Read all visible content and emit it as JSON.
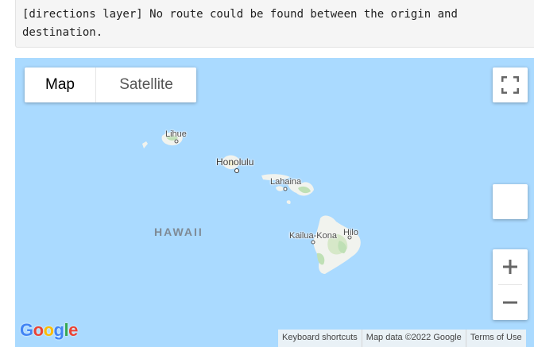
{
  "console": {
    "message": "[directions layer] No route could be found between the origin and\ndestination."
  },
  "map": {
    "type_control": {
      "map_label": "Map",
      "satellite_label": "Satellite",
      "selected": "Map"
    },
    "labels": {
      "lihue": "Lihue",
      "honolulu": "Honolulu",
      "lahaina": "Lahaina",
      "state": "HAWAII",
      "kailua_kona": "Kailua-Kona",
      "hilo": "Hilo"
    },
    "logo": {
      "letters": [
        "G",
        "o",
        "o",
        "g",
        "l",
        "e"
      ],
      "colors": [
        "#4285F4",
        "#EA4335",
        "#FBBC05",
        "#4285F4",
        "#34A853",
        "#EA4335"
      ]
    },
    "attribution": {
      "shortcuts": "Keyboard shortcuts",
      "map_data": "Map data ©2022 Google",
      "terms": "Terms of Use"
    },
    "colors": {
      "water": "#aadaff",
      "land": "#f1f3ee",
      "vegetation": "#bfe0b5"
    }
  }
}
